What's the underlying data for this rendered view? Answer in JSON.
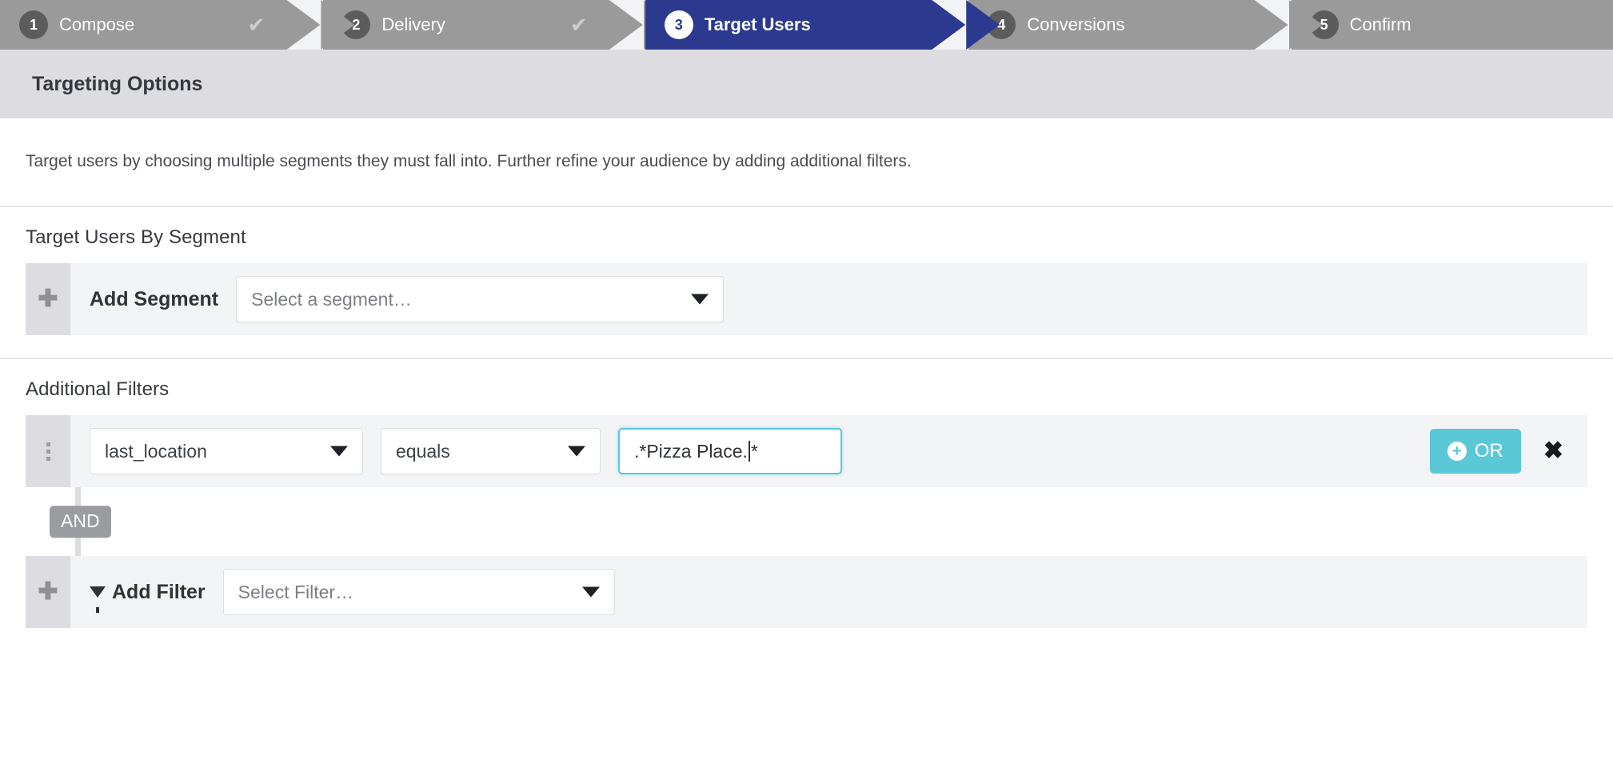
{
  "wizard": {
    "steps": [
      {
        "num": "1",
        "label": "Compose",
        "state": "complete",
        "check": "✔"
      },
      {
        "num": "2",
        "label": "Delivery",
        "state": "complete",
        "check": "✔"
      },
      {
        "num": "3",
        "label": "Target Users",
        "state": "active",
        "check": ""
      },
      {
        "num": "4",
        "label": "Conversions",
        "state": "upcoming",
        "check": ""
      },
      {
        "num": "5",
        "label": "Confirm",
        "state": "upcoming",
        "check": ""
      }
    ],
    "active_color": "#2b3a8f",
    "inactive_color": "#9a9a9a"
  },
  "panel": {
    "header_title": "Targeting Options",
    "description": "Target users by choosing multiple segments they must fall into. Further refine your audience by adding additional filters."
  },
  "segment_section": {
    "title": "Target Users By Segment",
    "add_row": {
      "handle_icon": "plus-icon",
      "handle_glyph": "✚",
      "label": "Add Segment",
      "select_placeholder": "Select a segment…",
      "caret_icon": "chevron-down-icon"
    }
  },
  "filters_section": {
    "title": "Additional Filters",
    "filter_row": {
      "handle_icon": "drag-handle-icon",
      "attribute_value": "last_location",
      "operator_value": "equals",
      "value_text_before_caret": ".*Pizza Place.",
      "value_text_after_caret": "*",
      "value_full": ".*Pizza Place.*",
      "or_button_label": "OR",
      "or_button_icon": "plus-circle-icon",
      "or_button_glyph": "+",
      "or_button_color": "#5bc8d8",
      "remove_icon": "close-icon",
      "remove_glyph": "✖",
      "focus_outline_color": "#5bc8d8"
    },
    "connector": {
      "label": "AND",
      "color": "#9a9ca0"
    },
    "add_row": {
      "handle_icon": "plus-icon",
      "handle_glyph": "✚",
      "funnel_icon": "funnel-icon",
      "label": "Add Filter",
      "select_placeholder": "Select Filter…",
      "caret_icon": "chevron-down-icon"
    }
  }
}
